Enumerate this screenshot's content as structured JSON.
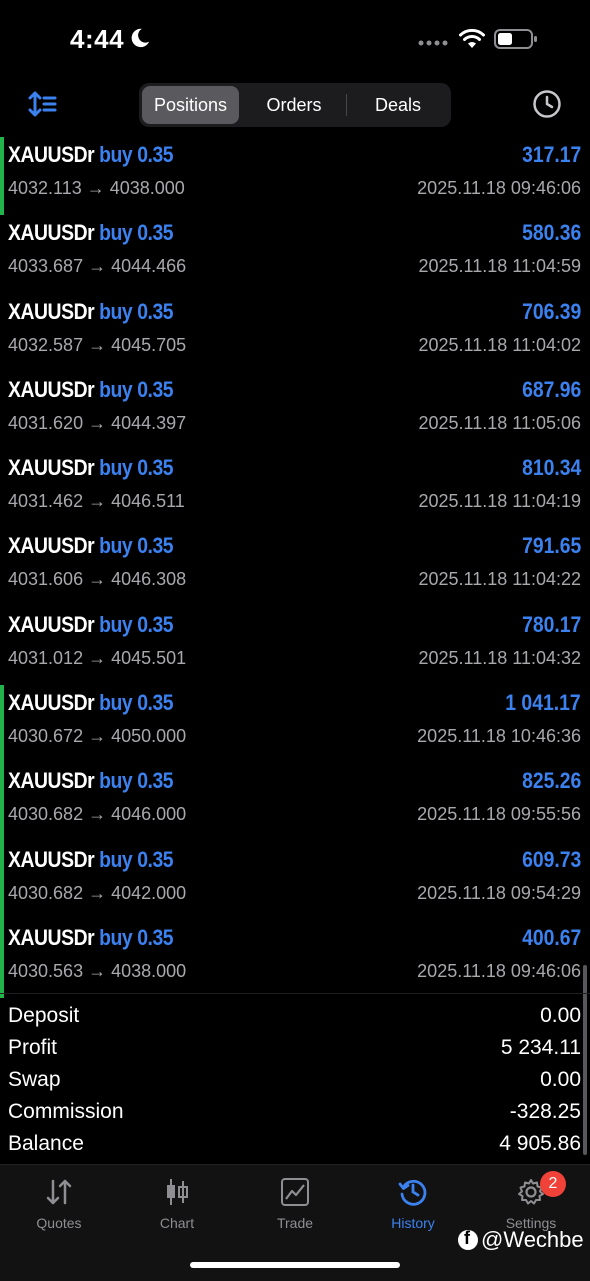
{
  "status_bar": {
    "time": "4:44"
  },
  "toolbar": {
    "tabs": [
      {
        "label": "Positions",
        "active": true
      },
      {
        "label": "Orders",
        "active": false
      },
      {
        "label": "Deals",
        "active": false
      }
    ]
  },
  "positions": [
    {
      "symbol": "XAUUSDr",
      "direction": "buy 0.35",
      "profit": "317.17",
      "prices": "4032.113 → 4038.000",
      "date": "2025.11.18 09:46:06",
      "highlighted": true
    },
    {
      "symbol": "XAUUSDr",
      "direction": "buy 0.35",
      "profit": "580.36",
      "prices": "4033.687 → 4044.466",
      "date": "2025.11.18 11:04:59",
      "highlighted": false
    },
    {
      "symbol": "XAUUSDr",
      "direction": "buy 0.35",
      "profit": "706.39",
      "prices": "4032.587 → 4045.705",
      "date": "2025.11.18 11:04:02",
      "highlighted": false
    },
    {
      "symbol": "XAUUSDr",
      "direction": "buy 0.35",
      "profit": "687.96",
      "prices": "4031.620 → 4044.397",
      "date": "2025.11.18 11:05:06",
      "highlighted": false
    },
    {
      "symbol": "XAUUSDr",
      "direction": "buy 0.35",
      "profit": "810.34",
      "prices": "4031.462 → 4046.511",
      "date": "2025.11.18 11:04:19",
      "highlighted": false
    },
    {
      "symbol": "XAUUSDr",
      "direction": "buy 0.35",
      "profit": "791.65",
      "prices": "4031.606 → 4046.308",
      "date": "2025.11.18 11:04:22",
      "highlighted": false
    },
    {
      "symbol": "XAUUSDr",
      "direction": "buy 0.35",
      "profit": "780.17",
      "prices": "4031.012 → 4045.501",
      "date": "2025.11.18 11:04:32",
      "highlighted": false
    },
    {
      "symbol": "XAUUSDr",
      "direction": "buy 0.35",
      "profit": "1 041.17",
      "prices": "4030.672 → 4050.000",
      "date": "2025.11.18 10:46:36",
      "highlighted": true
    },
    {
      "symbol": "XAUUSDr",
      "direction": "buy 0.35",
      "profit": "825.26",
      "prices": "4030.682 → 4046.000",
      "date": "2025.11.18 09:55:56",
      "highlighted": true
    },
    {
      "symbol": "XAUUSDr",
      "direction": "buy 0.35",
      "profit": "609.73",
      "prices": "4030.682 → 4042.000",
      "date": "2025.11.18 09:54:29",
      "highlighted": true
    },
    {
      "symbol": "XAUUSDr",
      "direction": "buy 0.35",
      "profit": "400.67",
      "prices": "4030.563 → 4038.000",
      "date": "2025.11.18 09:46:06",
      "highlighted": true
    }
  ],
  "summary": [
    {
      "label": "Deposit",
      "value": "0.00"
    },
    {
      "label": "Profit",
      "value": "5 234.11"
    },
    {
      "label": "Swap",
      "value": "0.00"
    },
    {
      "label": "Commission",
      "value": "-328.25"
    },
    {
      "label": "Balance",
      "value": "4 905.86"
    }
  ],
  "tabbar": {
    "items": [
      {
        "label": "Quotes",
        "icon": "quotes-icon",
        "active": false
      },
      {
        "label": "Chart",
        "icon": "candlestick-icon",
        "active": false
      },
      {
        "label": "Trade",
        "icon": "trade-chart-icon",
        "active": false
      },
      {
        "label": "History",
        "icon": "history-icon",
        "active": true
      },
      {
        "label": "Settings",
        "icon": "gear-icon",
        "active": false
      }
    ],
    "settings_badge": "2"
  },
  "watermark": "@Wechbe",
  "colors": {
    "accent": "#3b82f0",
    "highlight_bar": "#22b34a",
    "badge": "#f04238",
    "secondary_text": "#a8a8ad"
  }
}
